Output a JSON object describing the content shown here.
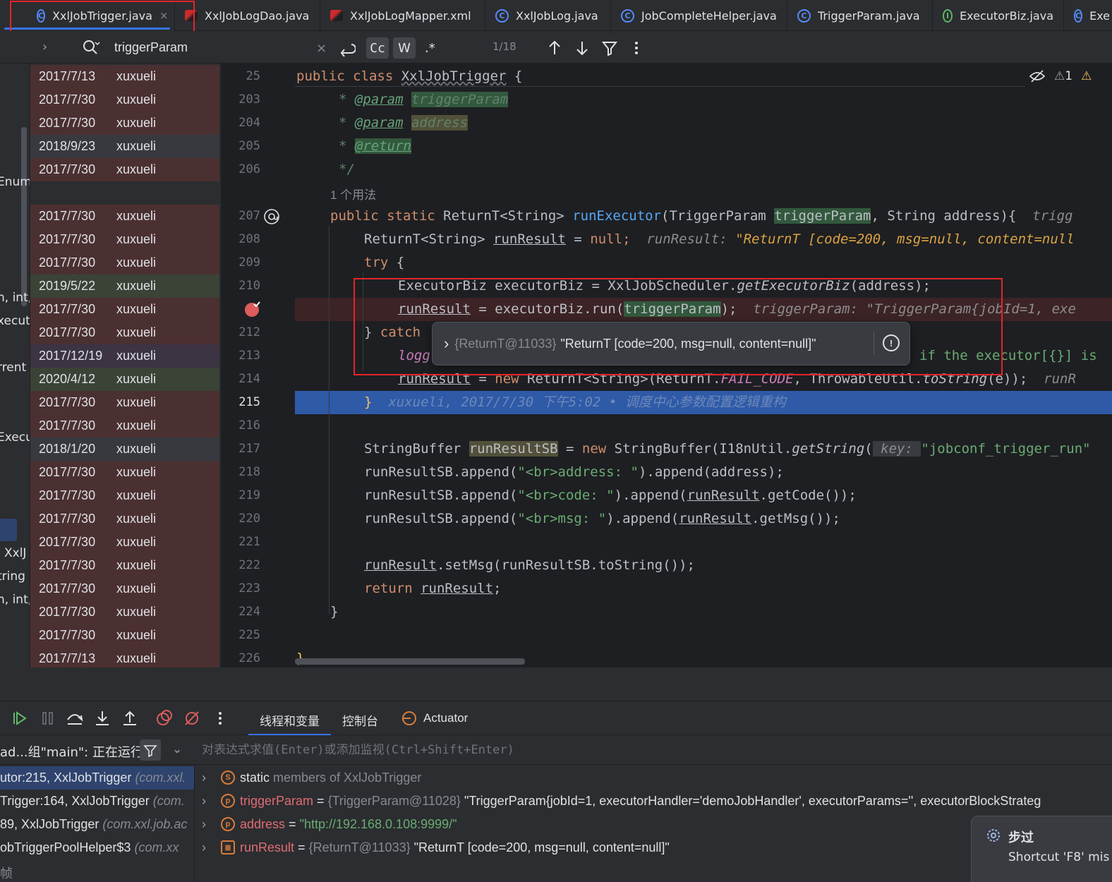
{
  "tabs": [
    {
      "label": "XxlJobTrigger.java",
      "icon": "class-icon",
      "active": true
    },
    {
      "label": "XxlJobLogDao.java",
      "icon": "mybatis-icon"
    },
    {
      "label": "XxlJobLogMapper.xml",
      "icon": "mybatis-xml-icon"
    },
    {
      "label": "XxlJobLog.java",
      "icon": "class-icon"
    },
    {
      "label": "JobCompleteHelper.java",
      "icon": "class-icon"
    },
    {
      "label": "TriggerParam.java",
      "icon": "class-icon"
    },
    {
      "label": "ExecutorBiz.java",
      "icon": "interface-icon"
    },
    {
      "label": "Exe",
      "icon": "class-icon"
    }
  ],
  "tab_close": "×",
  "tab_class_letter": "C",
  "tab_interface_letter": "I",
  "search": {
    "value": "triggerParam",
    "clear": "×",
    "case_label": "Cc",
    "word_label": "W",
    "regex_label": ".*",
    "match_count": "1/18"
  },
  "left_fragments": [
    "Enum",
    "n, int,",
    "xecut",
    ",",
    "rrent",
    "Execu",
    "XxlJ",
    "tring",
    "n, int,"
  ],
  "annotations": [
    {
      "date": "2017/7/13",
      "author": "xuxueli"
    },
    {
      "date": "2017/7/30",
      "author": "xuxueli"
    },
    {
      "date": "2017/7/30",
      "author": "xuxueli"
    },
    {
      "date": "2018/9/23",
      "author": "xuxueli"
    },
    {
      "date": "2017/7/30",
      "author": "xuxueli"
    },
    {
      "date": "2017/7/30",
      "author": "xuxueli"
    },
    {
      "date": "2017/7/30",
      "author": "xuxueli"
    },
    {
      "date": "2017/7/30",
      "author": "xuxueli"
    },
    {
      "date": "2019/5/22",
      "author": "xuxueli"
    },
    {
      "date": "2017/7/30",
      "author": "xuxueli"
    },
    {
      "date": "2017/7/30",
      "author": "xuxueli"
    },
    {
      "date": "2017/12/19",
      "author": "xuxueli"
    },
    {
      "date": "2020/4/12",
      "author": "xuxueli"
    },
    {
      "date": "2017/7/30",
      "author": "xuxueli"
    },
    {
      "date": "2017/7/30",
      "author": "xuxueli"
    },
    {
      "date": "2018/1/20",
      "author": "xuxueli"
    },
    {
      "date": "2017/7/30",
      "author": "xuxueli"
    },
    {
      "date": "2017/7/30",
      "author": "xuxueli"
    },
    {
      "date": "2017/7/30",
      "author": "xuxueli"
    },
    {
      "date": "2017/7/30",
      "author": "xuxueli"
    },
    {
      "date": "2017/7/30",
      "author": "xuxueli"
    },
    {
      "date": "2017/7/30",
      "author": "xuxueli"
    },
    {
      "date": "2017/7/30",
      "author": "xuxueli"
    },
    {
      "date": "2017/7/30",
      "author": "xuxueli"
    },
    {
      "date": "2017/7/13",
      "author": "xuxueli"
    }
  ],
  "line_numbers": [
    "25",
    "203",
    "204",
    "205",
    "206",
    "207",
    "208",
    "209",
    "210",
    "",
    "212",
    "213",
    "214",
    "215",
    "216",
    "217",
    "218",
    "219",
    "220",
    "221",
    "222",
    "223",
    "224",
    "225",
    "226"
  ],
  "usage_hint": "1 个用法",
  "editor_status": {
    "warning_count": "1"
  },
  "code": {
    "class_decl": {
      "kw": "public class ",
      "name": "XxlJobTrigger",
      "brace": " {"
    },
    "doc1": {
      "star": "* ",
      "tag": "@param",
      "sp": " ",
      "arg": "triggerParam"
    },
    "doc2": {
      "star": "* ",
      "tag": "@param",
      "sp": " ",
      "arg": "address"
    },
    "doc3": {
      "star": "* ",
      "tag": "@return"
    },
    "doc_end": "*/",
    "l207": {
      "kw": "public static ",
      "t1": "ReturnT<String> ",
      "fn": "runExecutor",
      "p1": "(TriggerParam ",
      "param": "triggerParam",
      "p2": ", String address){",
      "inlay": "  trigg"
    },
    "l208": {
      "t": "ReturnT<String> ",
      "var": "runResult",
      "eq": " = ",
      "nul": "null",
      "semi": ";",
      "inlay_k": "  runResult: ",
      "inlay_v": "\"ReturnT [code=200, msg=null, content=null"
    },
    "l209": {
      "kw": "try",
      "rest": " {"
    },
    "l210": {
      "t": "ExecutorBiz executorBiz = XxlJobScheduler.",
      "fn": "getExecutorBiz",
      "rest": "(address);"
    },
    "l211": {
      "var": "runResult",
      "eq": " = executorBiz.run(",
      "param": "triggerParam",
      "close": ");",
      "inlay_k": "  triggerParam: ",
      "inlay_v": "\"TriggerParam{jobId=1, exe"
    },
    "l212": {
      "brace": "} ",
      "kw": "catch"
    },
    "l213": {
      "log": "logg",
      "tail": "if the executor[{}] is"
    },
    "l214": {
      "var": "runResult",
      "eq": " = ",
      "kw": "new ",
      "t": "ReturnT<String>(ReturnT.",
      "cst": "FAIL_CODE",
      "rest": ", ThrowableUtil.",
      "fn": "toString",
      "end": "(e));",
      "inlay": "  runR"
    },
    "l215": {
      "brace": "}",
      "blame": "  xuxueli, 2017/7/30 下午5:02 • 调度中心参数配置逻辑重构"
    },
    "l217": {
      "t": "StringBuffer ",
      "var": "runResultSB",
      "eq": " = ",
      "kw": "new ",
      "t2": "StringBuffer(I18nUtil.",
      "fn": "getString",
      "paren": "(",
      "hint": " key: ",
      "str": "\"jobconf_trigger_run\""
    },
    "l218": {
      "a": "runResultSB.append(",
      "s": "\"<br>address: \"",
      "b": ").append(address);"
    },
    "l219": {
      "a": "runResultSB.append(",
      "s": "\"<br>code: \"",
      "b": ").append(",
      "var": "runResult",
      "c": ".getCode());"
    },
    "l220": {
      "a": "runResultSB.append(",
      "s": "\"<br>msg: \"",
      "b": ").append(",
      "var": "runResult",
      "c": ".getMsg());"
    },
    "l222": {
      "var": "runResult",
      "rest": ".setMsg(runResultSB.toString());"
    },
    "l223": {
      "kw": "return ",
      "var": "runResult",
      "semi": ";"
    },
    "l224": "}",
    "l226": "}"
  },
  "tooltip": {
    "chevron": "›",
    "ref": "{ReturnT@11033}",
    "value": "\"ReturnT [code=200, msg=null, content=null]\"",
    "info": "!"
  },
  "debug": {
    "tabs": [
      "线程和变量",
      "控制台",
      "Actuator"
    ],
    "thread_label": "ad...组\"main\": 正在运行",
    "eval_placeholder": "对表达式求值(Enter)或添加监视(Ctrl+Shift+Enter)",
    "frames": [
      {
        "text": "utor:215, XxlJobTrigger ",
        "pkg": "(com.xxl."
      },
      {
        "text": "Trigger:164, XxlJobTrigger ",
        "pkg": "(com."
      },
      {
        "text": "89, XxlJobTrigger ",
        "pkg": "(com.xxl.job.ac"
      },
      {
        "text": "obTriggerPoolHelper$3 ",
        "pkg": "(com.xx"
      },
      {
        "text": "帧",
        "pkg": ""
      }
    ],
    "variables": [
      {
        "icon": "S",
        "name": "static members of XxlJobTrigger",
        "name_plain": "static",
        "rest": " members of XxlJobTrigger"
      },
      {
        "icon": "p",
        "name": "triggerParam",
        "eq": " = ",
        "ref": "{TriggerParam@11028} ",
        "value": "\"TriggerParam{jobId=1, executorHandler='demoJobHandler', executorParams='', executorBlockStrateg"
      },
      {
        "icon": "p",
        "name": "address",
        "eq": " = ",
        "value": "\"http://192.168.0.108:9999/\""
      },
      {
        "icon": "≣",
        "name": "runResult",
        "eq": " = ",
        "ref": "{ReturnT@11033} ",
        "value": "\"ReturnT [code=200, msg=null, content=null]\""
      }
    ],
    "toast": {
      "title": "步过",
      "body": "Shortcut 'F8' mis"
    }
  },
  "colors": {
    "accent": "#3574f0",
    "highlight_box": "#e5252a",
    "exec_line": "#2e5aa8",
    "breakpoint": "#db5c5c"
  }
}
